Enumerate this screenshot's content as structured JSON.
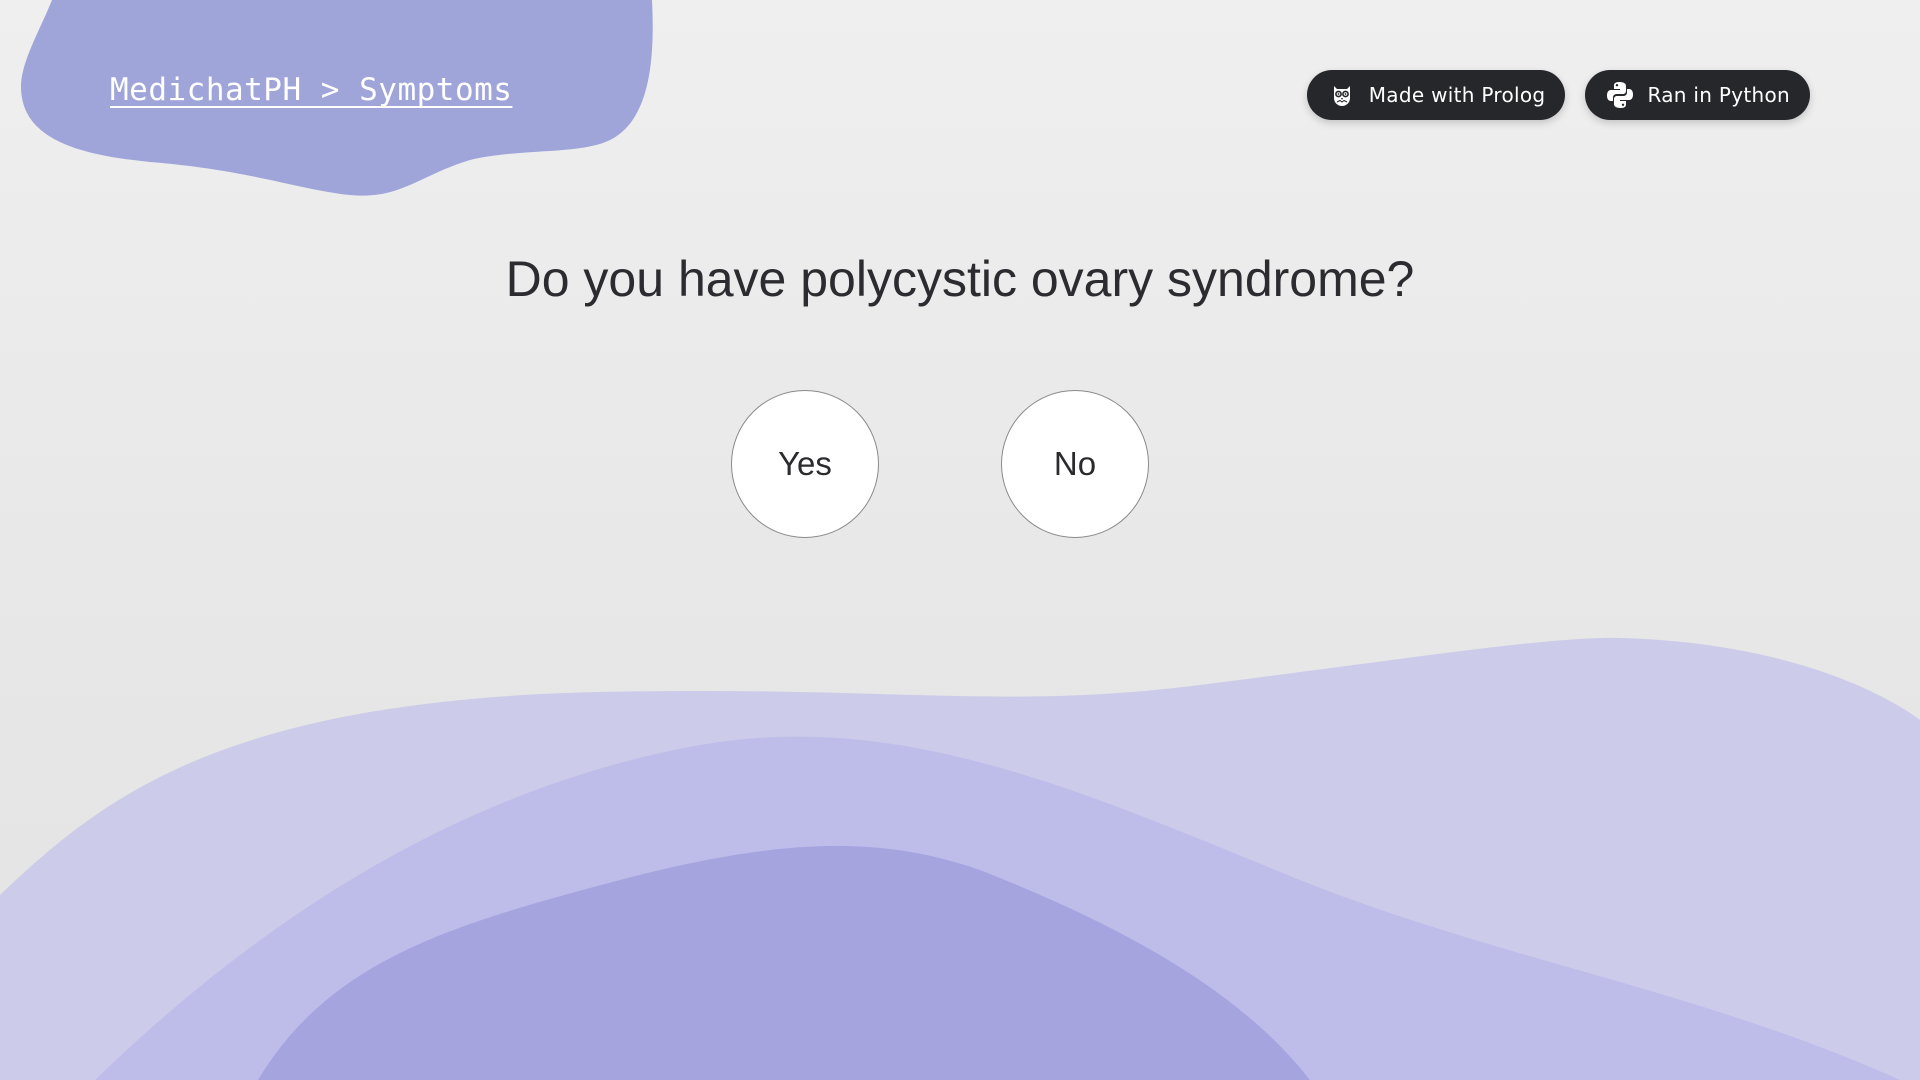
{
  "colors": {
    "blob_top_left": "#9fa5d9",
    "wave_back": "#cccbe9",
    "wave_mid": "#bebdea",
    "wave_front": "#a6a4df",
    "badge_bg": "#26272b",
    "button_bg": "#ffffff"
  },
  "header": {
    "breadcrumb": "MedichatPH > Symptoms"
  },
  "badges": [
    {
      "label": "Made with Prolog",
      "icon": "owl-icon"
    },
    {
      "label": "Ran in Python",
      "icon": "python-icon"
    }
  ],
  "main": {
    "question": "Do you have polycystic ovary syndrome?",
    "answers": {
      "yes_label": "Yes",
      "no_label": "No"
    }
  }
}
